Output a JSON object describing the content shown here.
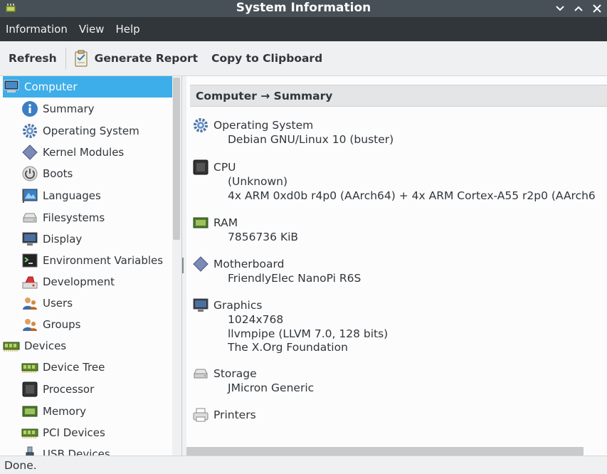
{
  "window": {
    "title": "System Information"
  },
  "menubar": {
    "items": [
      "Information",
      "View",
      "Help"
    ]
  },
  "toolbar": {
    "refresh": "Refresh",
    "generate_report": "Generate Report",
    "copy": "Copy to Clipboard"
  },
  "sidebar": {
    "items": [
      {
        "label": "Computer",
        "icon": "computer-icon",
        "level": 0,
        "selected": true
      },
      {
        "label": "Summary",
        "icon": "info-icon",
        "level": 1
      },
      {
        "label": "Operating System",
        "icon": "gear-icon",
        "level": 1
      },
      {
        "label": "Kernel Modules",
        "icon": "module-icon",
        "level": 1
      },
      {
        "label": "Boots",
        "icon": "power-icon",
        "level": 1
      },
      {
        "label": "Languages",
        "icon": "flag-icon",
        "level": 1
      },
      {
        "label": "Filesystems",
        "icon": "drive-icon",
        "level": 1
      },
      {
        "label": "Display",
        "icon": "monitor-icon",
        "level": 1
      },
      {
        "label": "Environment Variables",
        "icon": "terminal-icon",
        "level": 1
      },
      {
        "label": "Development",
        "icon": "development-icon",
        "level": 1
      },
      {
        "label": "Users",
        "icon": "users-icon",
        "level": 1
      },
      {
        "label": "Groups",
        "icon": "groups-icon",
        "level": 1
      },
      {
        "label": "Devices",
        "icon": "memory-card-icon",
        "level": 0
      },
      {
        "label": "Device Tree",
        "icon": "memory-card-icon",
        "level": 1
      },
      {
        "label": "Processor",
        "icon": "cpu-icon",
        "level": 1
      },
      {
        "label": "Memory",
        "icon": "ram-icon",
        "level": 1
      },
      {
        "label": "PCI Devices",
        "icon": "memory-card-icon",
        "level": 1
      },
      {
        "label": "USB Devices",
        "icon": "usb-icon",
        "level": 1
      }
    ]
  },
  "content": {
    "header": "Computer → Summary",
    "sections": [
      {
        "title": "Operating System",
        "icon": "gear-icon",
        "values": [
          "Debian GNU/Linux 10 (buster)"
        ]
      },
      {
        "title": "CPU",
        "icon": "cpu-icon",
        "values": [
          "(Unknown)",
          "4x ARM 0xd0b r4p0 (AArch64) + 4x ARM Cortex-A55 r2p0 (AArch6"
        ]
      },
      {
        "title": "RAM",
        "icon": "ram-icon",
        "values": [
          "7856736 KiB"
        ]
      },
      {
        "title": "Motherboard",
        "icon": "module-icon",
        "values": [
          "FriendlyElec NanoPi R6S"
        ]
      },
      {
        "title": "Graphics",
        "icon": "monitor-icon",
        "values": [
          "1024x768",
          "llvmpipe (LLVM 7.0, 128 bits)",
          "The X.Org Foundation"
        ]
      },
      {
        "title": "Storage",
        "icon": "drive-icon",
        "values": [
          "JMicron Generic"
        ]
      },
      {
        "title": "Printers",
        "icon": "printer-icon",
        "values": []
      }
    ]
  },
  "statusbar": {
    "text": "Done."
  },
  "colors": {
    "selection": "#3daee9",
    "titlebar": "#475057",
    "menubar": "#31363b"
  }
}
